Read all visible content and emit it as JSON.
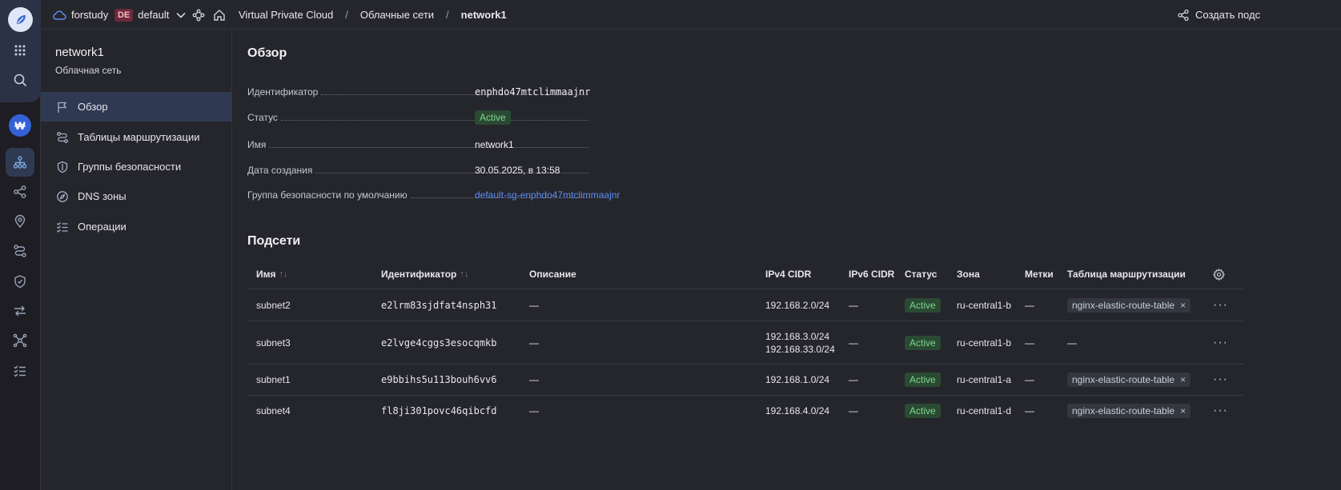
{
  "header": {
    "cloud_name": "forstudy",
    "folder_badge": "DE",
    "folder_name": "default",
    "breadcrumb": [
      "Virtual Private Cloud",
      "Облачные сети",
      "network1"
    ],
    "breadcrumb_sep": "/",
    "create_label": "Создать подс"
  },
  "rail": {
    "icons": [
      "app-logo-icon",
      "services-grid-icon",
      "search-icon",
      "billing-account-icon",
      "cloud-networks-icon",
      "routing-icon",
      "ip-address-icon",
      "route-tables-icon",
      "security-groups-icon",
      "gateways-icon",
      "topology-icon",
      "operations-icon"
    ],
    "wallet_glyph": "₩"
  },
  "sidebar": {
    "title": "network1",
    "subtitle": "Облачная сеть",
    "items": [
      {
        "label": "Обзор",
        "icon": "flag-icon"
      },
      {
        "label": "Таблицы маршрутизации",
        "icon": "route-icon"
      },
      {
        "label": "Группы безопасности",
        "icon": "shield-icon"
      },
      {
        "label": "DNS зоны",
        "icon": "compass-icon"
      },
      {
        "label": "Операции",
        "icon": "checklist-icon"
      }
    ]
  },
  "overview": {
    "title": "Обзор",
    "props": [
      {
        "label": "Идентификатор",
        "value": "enphdo47mtclimmaajnr"
      },
      {
        "label": "Статус",
        "value": "Active"
      },
      {
        "label": "Имя",
        "value": "network1"
      },
      {
        "label": "Дата создания",
        "value": "30.05.2025, в 13:58"
      },
      {
        "label": "Группа безопасности по умолчанию",
        "value": "default-sg-enphdo47mtclimmaajnr"
      }
    ]
  },
  "subnets": {
    "title": "Подсети",
    "columns": [
      "Имя",
      "Идентификатор",
      "Описание",
      "IPv4 CIDR",
      "IPv6 CIDR",
      "Статус",
      "Зона",
      "Метки",
      "Таблица маршрутизации"
    ],
    "sort_glyph": "↑↓",
    "rows": [
      {
        "name": "subnet2",
        "id": "e2lrm83sjdfat4nsph31",
        "desc": "—",
        "ipv4": [
          "192.168.2.0/24"
        ],
        "ipv6": "—",
        "status": "Active",
        "zone": "ru-central1-b",
        "labels": "—",
        "route_table": "nginx-elastic-route-table"
      },
      {
        "name": "subnet3",
        "id": "e2lvge4cggs3esocqmkb",
        "desc": "—",
        "ipv4": [
          "192.168.3.0/24",
          "192.168.33.0/24"
        ],
        "ipv6": "—",
        "status": "Active",
        "zone": "ru-central1-b",
        "labels": "—",
        "route_table": "—"
      },
      {
        "name": "subnet1",
        "id": "e9bbihs5u113bouh6vv6",
        "desc": "—",
        "ipv4": [
          "192.168.1.0/24"
        ],
        "ipv6": "—",
        "status": "Active",
        "zone": "ru-central1-a",
        "labels": "—",
        "route_table": "nginx-elastic-route-table"
      },
      {
        "name": "subnet4",
        "id": "fl8ji301povc46qibcfd",
        "desc": "—",
        "ipv4": [
          "192.168.4.0/24"
        ],
        "ipv6": "—",
        "status": "Active",
        "zone": "ru-central1-d",
        "labels": "—",
        "route_table": "nginx-elastic-route-table"
      }
    ],
    "tag_close": "×",
    "row_menu": "···"
  }
}
